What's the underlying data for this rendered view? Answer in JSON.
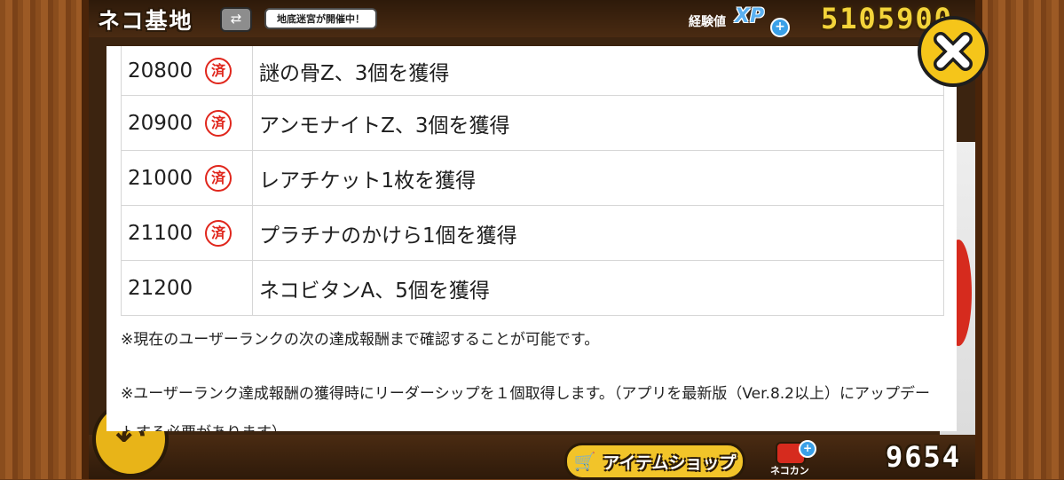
{
  "header": {
    "title": "ネコ基地",
    "switch_label": "⇄",
    "event_badge": "地底迷宮が開催中！",
    "xp_label": "経験値",
    "xp_icon_text": "XP",
    "xp_plus": "+",
    "xp_value": "5105900"
  },
  "modal": {
    "rows": [
      {
        "rank": "20800",
        "reward": "謎の骨Z、3個を獲得",
        "completed": true
      },
      {
        "rank": "20900",
        "reward": "アンモナイトZ、3個を獲得",
        "completed": true
      },
      {
        "rank": "21000",
        "reward": "レアチケット1枚を獲得",
        "completed": true
      },
      {
        "rank": "21100",
        "reward": "プラチナのかけら1個を獲得",
        "completed": true
      },
      {
        "rank": "21200",
        "reward": "ネコビタンA、5個を獲得",
        "completed": false
      }
    ],
    "stamp_text": "済",
    "note_1": "※現在のユーザーランクの次の達成報酬まで確認することが可能です。",
    "note_2": "※ユーザーランク達成報酬の獲得時にリーダーシップを１個取得します。（アプリを最新版（Ver.8.2以上）にアップデートする必要があります）"
  },
  "footer": {
    "back_symbol": "↶",
    "shop_label": "アイテムショップ",
    "cat_can_label": "ネコカン",
    "cat_can_plus": "+",
    "cat_can_value": "9654"
  },
  "colors": {
    "stamp_red": "#e0261c",
    "close_yellow": "#f5c51a",
    "xp_gold": "#f3d43a",
    "wood_brown": "#8a4d1d"
  },
  "icons": {
    "close": "close-x-icon",
    "cart": "shopping-cart-icon",
    "back": "back-arrow-icon",
    "cat_can": "cat-can-icon",
    "switch": "swap-icon"
  }
}
